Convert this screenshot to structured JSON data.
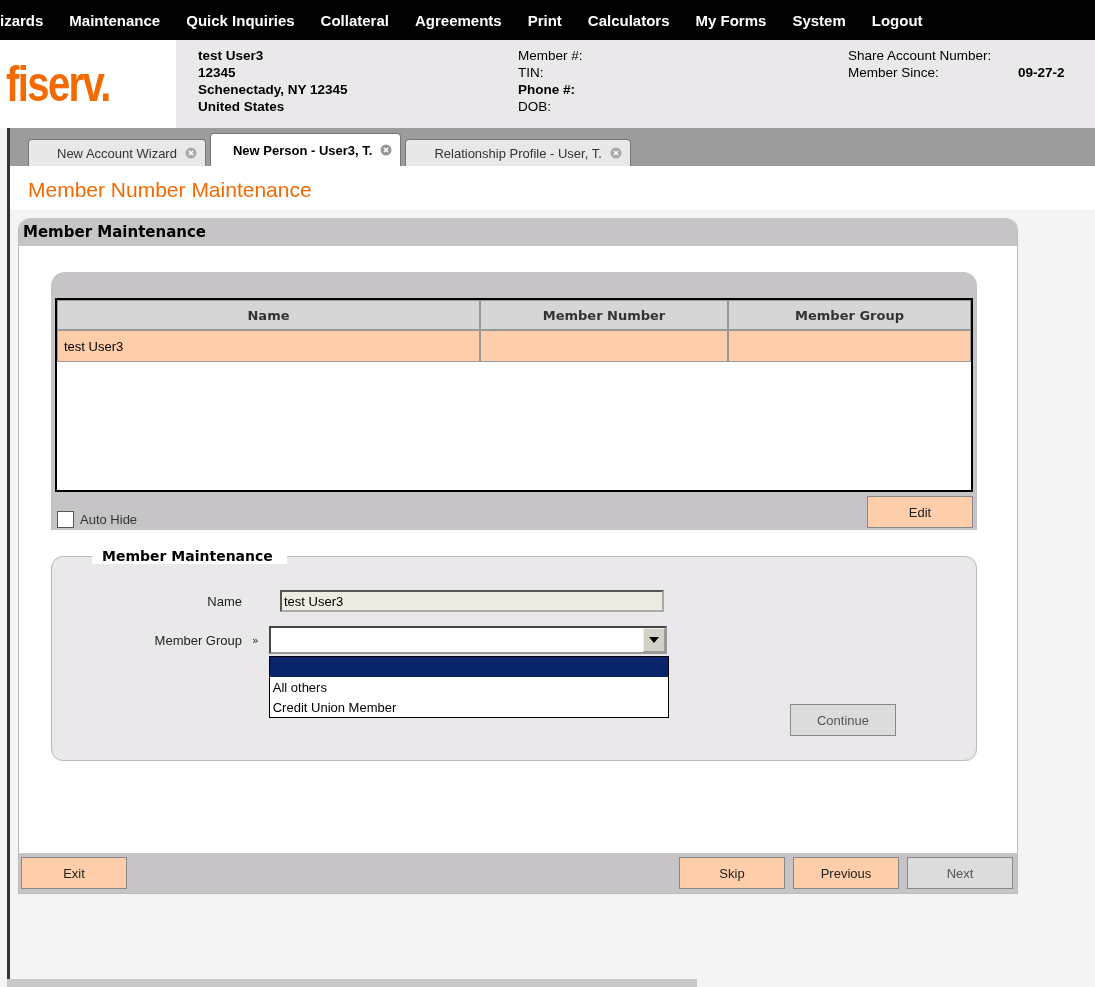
{
  "menu": [
    "izards",
    "Maintenance",
    "Quick Inquiries",
    "Collateral",
    "Agreements",
    "Print",
    "Calculators",
    "My Forms",
    "System",
    "Logout"
  ],
  "header": {
    "logo": "fiserv.",
    "address": [
      "test User3",
      "12345",
      "Schenectady, NY 12345",
      "United States"
    ],
    "member_fields": [
      {
        "label": "Member #:",
        "bold": false
      },
      {
        "label": "TIN:",
        "bold": false
      },
      {
        "label": "Phone #:",
        "bold": true
      },
      {
        "label": "DOB:",
        "bold": false
      }
    ],
    "account_fields": [
      {
        "label": "Share Account Number:"
      },
      {
        "label": "Member Since:",
        "value": "09-27-2"
      }
    ]
  },
  "tabs": [
    {
      "label": "New Account Wizard",
      "selected": false
    },
    {
      "label": "New Person - User3, T.",
      "selected": true
    },
    {
      "label": "Relationship Profile - User, T.",
      "selected": false
    }
  ],
  "page_title": "Member Number Maintenance",
  "panel": {
    "title": "Member Maintenance",
    "table": {
      "columns": [
        "Name",
        "Member Number",
        "Member Group"
      ],
      "rows": [
        {
          "cells": [
            "test User3",
            "",
            ""
          ],
          "selected": true
        }
      ]
    },
    "auto_hide": {
      "label": "Auto Hide",
      "checked": false
    },
    "edit_button": "Edit",
    "form": {
      "legend": "Member Maintenance",
      "name_label": "Name",
      "name_value": "test User3",
      "group_label": "Member Group",
      "group_marker": "»",
      "dropdown": {
        "open": true,
        "blank_option_highlighted": true,
        "options": [
          "All others",
          "Credit Union Member"
        ]
      },
      "continue_button": {
        "label": "Continue",
        "disabled": true
      }
    },
    "footer_left_buttons": [
      {
        "label": "Exit",
        "disabled": false
      }
    ],
    "footer_right_buttons": [
      {
        "label": "Skip",
        "disabled": false
      },
      {
        "label": "Previous",
        "disabled": false
      },
      {
        "label": "Next",
        "disabled": true
      }
    ]
  }
}
